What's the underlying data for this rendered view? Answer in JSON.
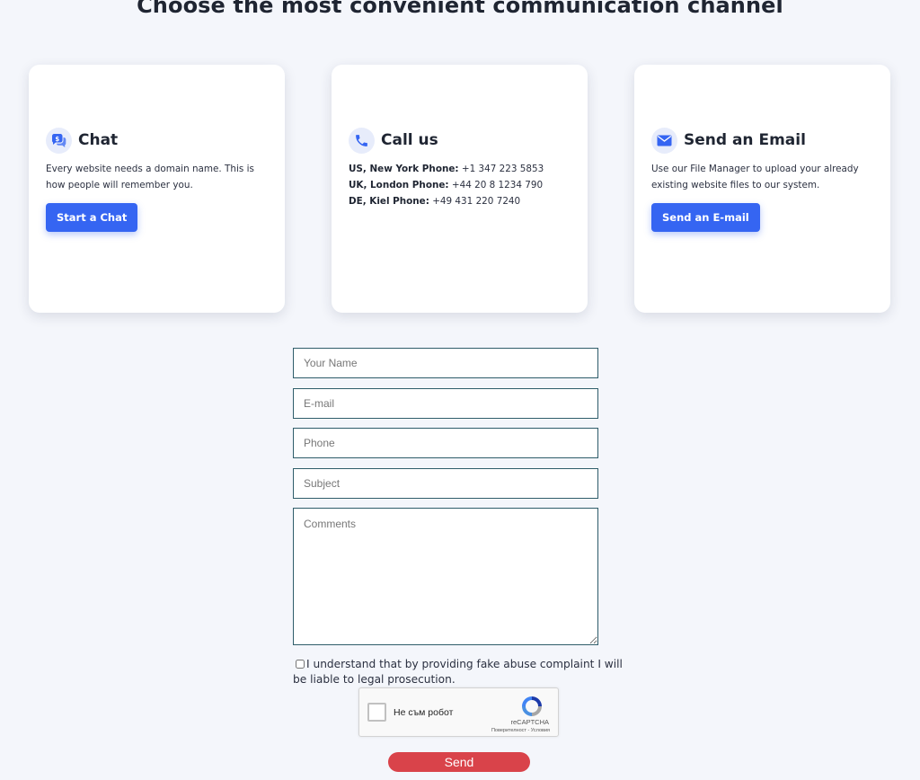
{
  "page": {
    "heading": "Choose the most convenient communication channel"
  },
  "cards": {
    "chat": {
      "title": "Chat",
      "icon": "chat-bubbles-icon",
      "text": "Every website needs a domain name. This is how people will remember you.",
      "button": "Start a Chat"
    },
    "call": {
      "title": "Call us",
      "icon": "phone-icon",
      "phones": [
        {
          "label": "US, New York Phone:",
          "number": "+1 347 223 5853"
        },
        {
          "label": "UK, London Phone:",
          "number": "+44 20 8 1234 790"
        },
        {
          "label": "DE, Kiel Phone:",
          "number": "+49 431 220 7240"
        }
      ]
    },
    "email": {
      "title": "Send an Email",
      "icon": "envelope-icon",
      "text": "Use our File Manager to upload your already existing website files to our system.",
      "button": "Send an E-mail"
    }
  },
  "form": {
    "name_placeholder": "Your Name",
    "email_placeholder": "E-mail",
    "phone_placeholder": "Phone",
    "subject_placeholder": "Subject",
    "comments_placeholder": "Comments",
    "consent_text": "I understand that by providing fake abuse complaint I will be liable to legal prosecution.",
    "consent_checked": false,
    "recaptcha": {
      "label": "Не съм робот",
      "brand": "reCAPTCHA",
      "links": "Поверителност - Условия"
    },
    "send_label": "Send"
  },
  "colors": {
    "accent_blue": "#3565f2",
    "send_red": "#d9434a",
    "background": "#f4f6fb",
    "icon_bg": "#e7ecfb"
  }
}
